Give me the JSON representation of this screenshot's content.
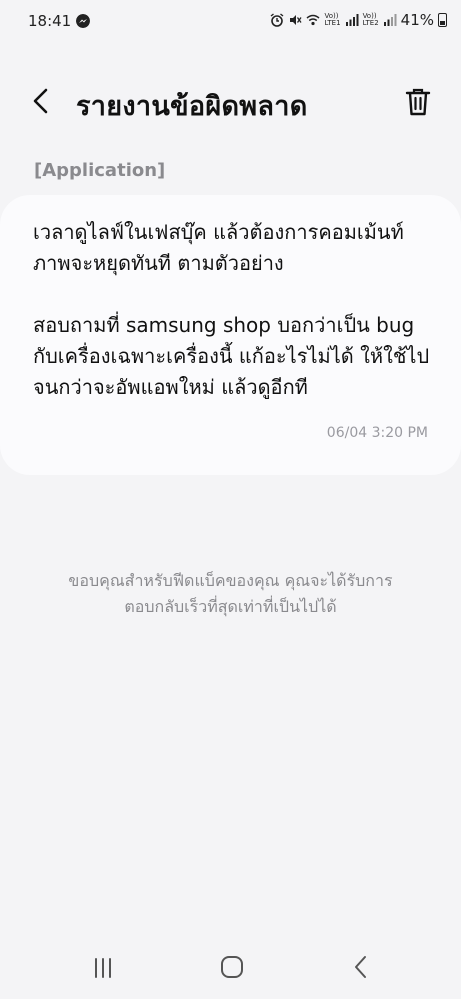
{
  "status_bar": {
    "time": "18:41",
    "battery": "41%",
    "icons": [
      "messenger-icon",
      "alarm-icon",
      "mute-icon",
      "wifi-icon",
      "volte-lte1-icon",
      "signal-icon",
      "volte-lte2-icon",
      "signal-icon",
      "battery-icon"
    ],
    "lte1_label": "LTE1",
    "lte2_label": "LTE2",
    "volte_label": "Vo))"
  },
  "header": {
    "title": "รายงานข้อผิดพลาด",
    "back_icon": "chevron-left-icon",
    "delete_icon": "trash-icon"
  },
  "category": "[Application]",
  "message": {
    "text": "เวลาดูไลฟ์ในเฟสบุ๊ค แล้วต้องการคอมเม้นท์ ภาพจะหยุดทันที ตามตัวอย่าง\n\nสอบถามที่ samsung shop บอกว่าเป็น bug กับเครื่องเฉพาะเครื่องนี้ แก้อะไรไม่ได้ ให้ใช้ไปจนกว่าจะอัพแอพใหม่ แล้วดูอีกที",
    "time": "06/04 3:20 PM"
  },
  "thanks": "ขอบคุณสำหรับฟีดแบ็คของคุณ คุณจะได้รับการ\nตอบกลับเร็วที่สุดเท่าที่เป็นไปได้",
  "nav_bar": {
    "items": [
      "recent-apps-icon",
      "home-icon",
      "back-icon"
    ]
  },
  "colors": {
    "background": "#f4f4f6",
    "card": "#fbfbfd",
    "muted_text": "#8a8a8e"
  }
}
